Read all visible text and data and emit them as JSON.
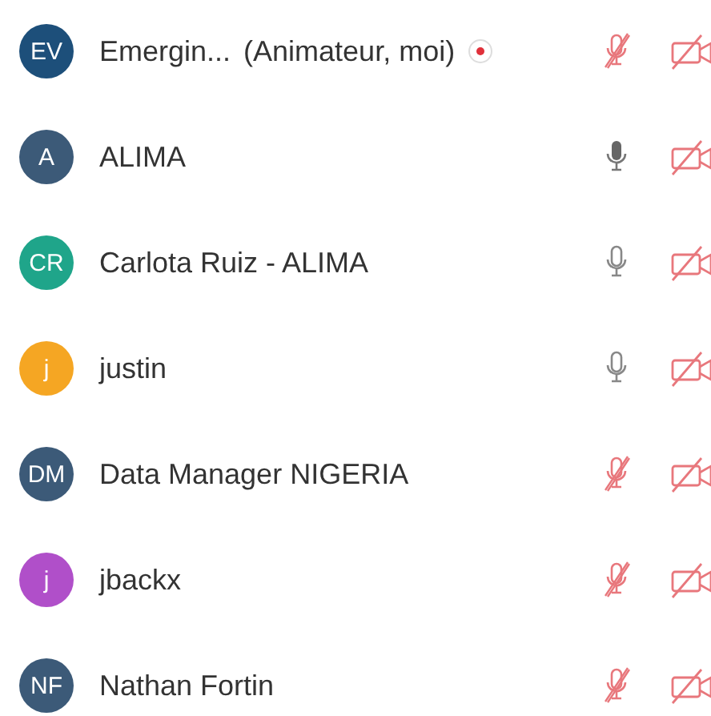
{
  "participants": [
    {
      "initials": "EV",
      "color": "#1d4f7a",
      "name": "Emergin...",
      "role": "(Animateur, moi)",
      "recording": true,
      "muted": true,
      "camera_on": false
    },
    {
      "initials": "A",
      "color": "#3c5a78",
      "name": "ALIMA",
      "recording": false,
      "muted": false,
      "speaking": true,
      "camera_on": false
    },
    {
      "initials": "CR",
      "color": "#1fa58a",
      "name": "Carlota Ruiz - ALIMA",
      "recording": false,
      "muted": false,
      "speaking": false,
      "camera_on": false
    },
    {
      "initials": "j",
      "color": "#f5a623",
      "name": "justin",
      "recording": false,
      "muted": false,
      "speaking": false,
      "camera_on": false
    },
    {
      "initials": "DM",
      "color": "#3c5a78",
      "name": "Data Manager NIGERIA",
      "recording": false,
      "muted": true,
      "camera_on": false
    },
    {
      "initials": "j",
      "color": "#b04fc9",
      "name": "jbackx",
      "recording": false,
      "muted": true,
      "camera_on": false
    },
    {
      "initials": "NF",
      "color": "#3c5a78",
      "name": "Nathan Fortin",
      "recording": false,
      "muted": true,
      "camera_on": false
    }
  ]
}
